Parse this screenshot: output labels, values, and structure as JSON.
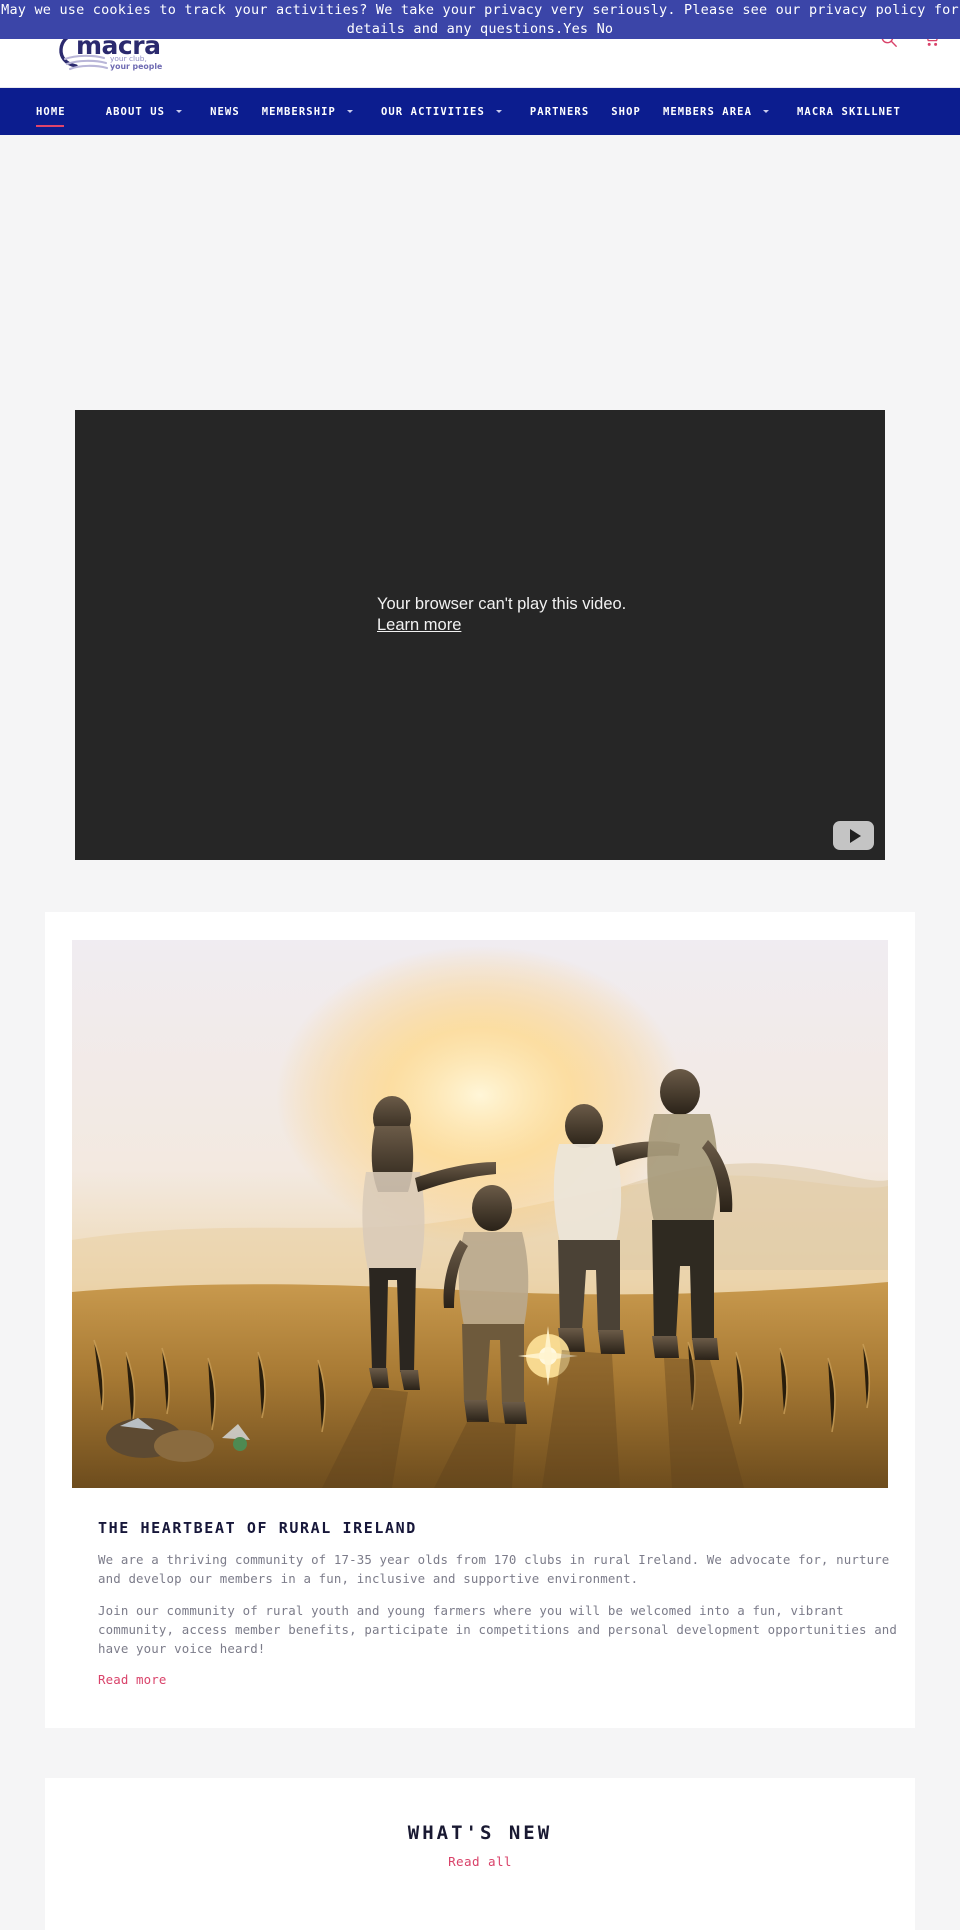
{
  "cookie_banner": {
    "message": "May we use cookies to track your activities? We take your privacy very seriously. Please see our privacy policy for details and any questions.",
    "accept_label": "Yes",
    "decline_label": "No",
    "background_color": "#3b45a8",
    "text_color": "#ffffff"
  },
  "header": {
    "logo": {
      "wordmark": "macra",
      "tagline_line1": "your club,",
      "tagline_line2": "your people",
      "color": "#2b2a6e",
      "tagline_color": "#8e8bc4"
    },
    "icons": {
      "search": "search-icon",
      "cart": "cart-icon",
      "color": "#d9436a"
    }
  },
  "nav": {
    "background_color": "#0c1d8f",
    "active_indicator_color": "#e0446b",
    "items": [
      {
        "label": "HOME",
        "has_dropdown": false,
        "active": true
      },
      {
        "label": "ABOUT US",
        "has_dropdown": true,
        "active": false
      },
      {
        "label": "NEWS",
        "has_dropdown": false,
        "active": false
      },
      {
        "label": "MEMBERSHIP",
        "has_dropdown": true,
        "active": false
      },
      {
        "label": "OUR ACTIVITIES",
        "has_dropdown": true,
        "active": false
      },
      {
        "label": "PARTNERS",
        "has_dropdown": false,
        "active": false
      },
      {
        "label": "SHOP",
        "has_dropdown": false,
        "active": false
      },
      {
        "label": "MEMBERS AREA",
        "has_dropdown": true,
        "active": false
      },
      {
        "label": "MACRA SKILLNET",
        "has_dropdown": false,
        "active": false
      }
    ]
  },
  "video": {
    "error_message": "Your browser can't play this video.",
    "learn_more_label": "Learn more",
    "play_button": "play-icon",
    "background_color": "#262626"
  },
  "heartbeat_card": {
    "image_alt": "Four friends standing arm in arm watching a golden sunset over rural hills",
    "title": "THE HEARTBEAT OF RURAL IRELAND",
    "paragraph_1": "We are a thriving community of 17-35 year olds from 170 clubs in rural Ireland. We advocate for, nurture and develop our members in a fun, inclusive and supportive environment.",
    "paragraph_2": "Join our community of rural youth and young farmers where you will be welcomed into a fun, vibrant community, access member benefits, participate in competitions and personal development opportunities and have your voice heard!",
    "read_more_label": "Read more",
    "link_color": "#d9436a"
  },
  "whats_new": {
    "title": "WHAT'S NEW",
    "read_all_label": "Read all",
    "link_color": "#d9436a"
  },
  "page": {
    "background_color": "#f5f5f6",
    "card_background_color": "#ffffff"
  }
}
